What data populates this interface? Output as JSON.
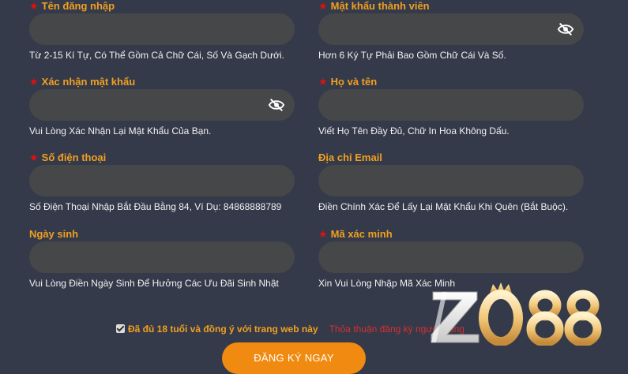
{
  "form": {
    "fields": [
      {
        "label": "Tên đăng nhập",
        "required": true,
        "password": false,
        "value": "",
        "hint": "Từ 2-15 Kí Tự, Có Thể Gồm Cả Chữ Cái, Số Và Gạch Dưới."
      },
      {
        "label": "Mật khẩu thành viên",
        "required": true,
        "password": true,
        "value": "",
        "hint": "Hơn 6 Ký Tự Phải Bao Gồm Chữ Cái Và Số."
      },
      {
        "label": "Xác nhận mật khẩu",
        "required": true,
        "password": true,
        "value": "",
        "hint": "Vui Lòng Xác Nhận Lại Mật Khẩu Của Bạn."
      },
      {
        "label": "Họ và tên",
        "required": true,
        "password": false,
        "value": "",
        "hint": "Viết Họ Tên Đầy Đủ, Chữ In Hoa Không Dấu."
      },
      {
        "label": "Số điện thoại",
        "required": true,
        "password": false,
        "value": "",
        "hint": "Số Điện Thoại Nhập Bắt Đầu Bằng 84, Ví Dụ: 84868888789"
      },
      {
        "label": "Địa chỉ Email",
        "required": false,
        "password": false,
        "value": "",
        "hint": "Điền Chính Xác Để Lấy Lại Mật Khẩu Khi Quên (Bắt Buộc)."
      },
      {
        "label": "Ngày sinh",
        "required": false,
        "password": false,
        "value": "",
        "hint": "Vui Lòng Điền Ngày Sinh Để Hưởng Các Ưu Đãi Sinh Nhật"
      },
      {
        "label": "Mã xác minh",
        "required": true,
        "password": false,
        "value": "",
        "hint": "Xin Vui Lòng Nhập Mã Xác Minh"
      }
    ],
    "agree_text": "Đã đủ 18 tuổi và đồng ý với trang web này",
    "agree_checked": true,
    "terms_link": "Thỏa thuận đăng ký người dùng",
    "submit_label": "ĐĂNG KÝ NGAY"
  },
  "logo": {
    "text": "ZO88"
  },
  "colors": {
    "background": "#343a4a",
    "input": "#464748",
    "label": "#f0a020",
    "required_star": "#e01010",
    "button": "#f08a10",
    "terms_link": "#d83030"
  },
  "icons": {
    "eye": "eye-slash-icon",
    "star": "required-star-icon"
  }
}
